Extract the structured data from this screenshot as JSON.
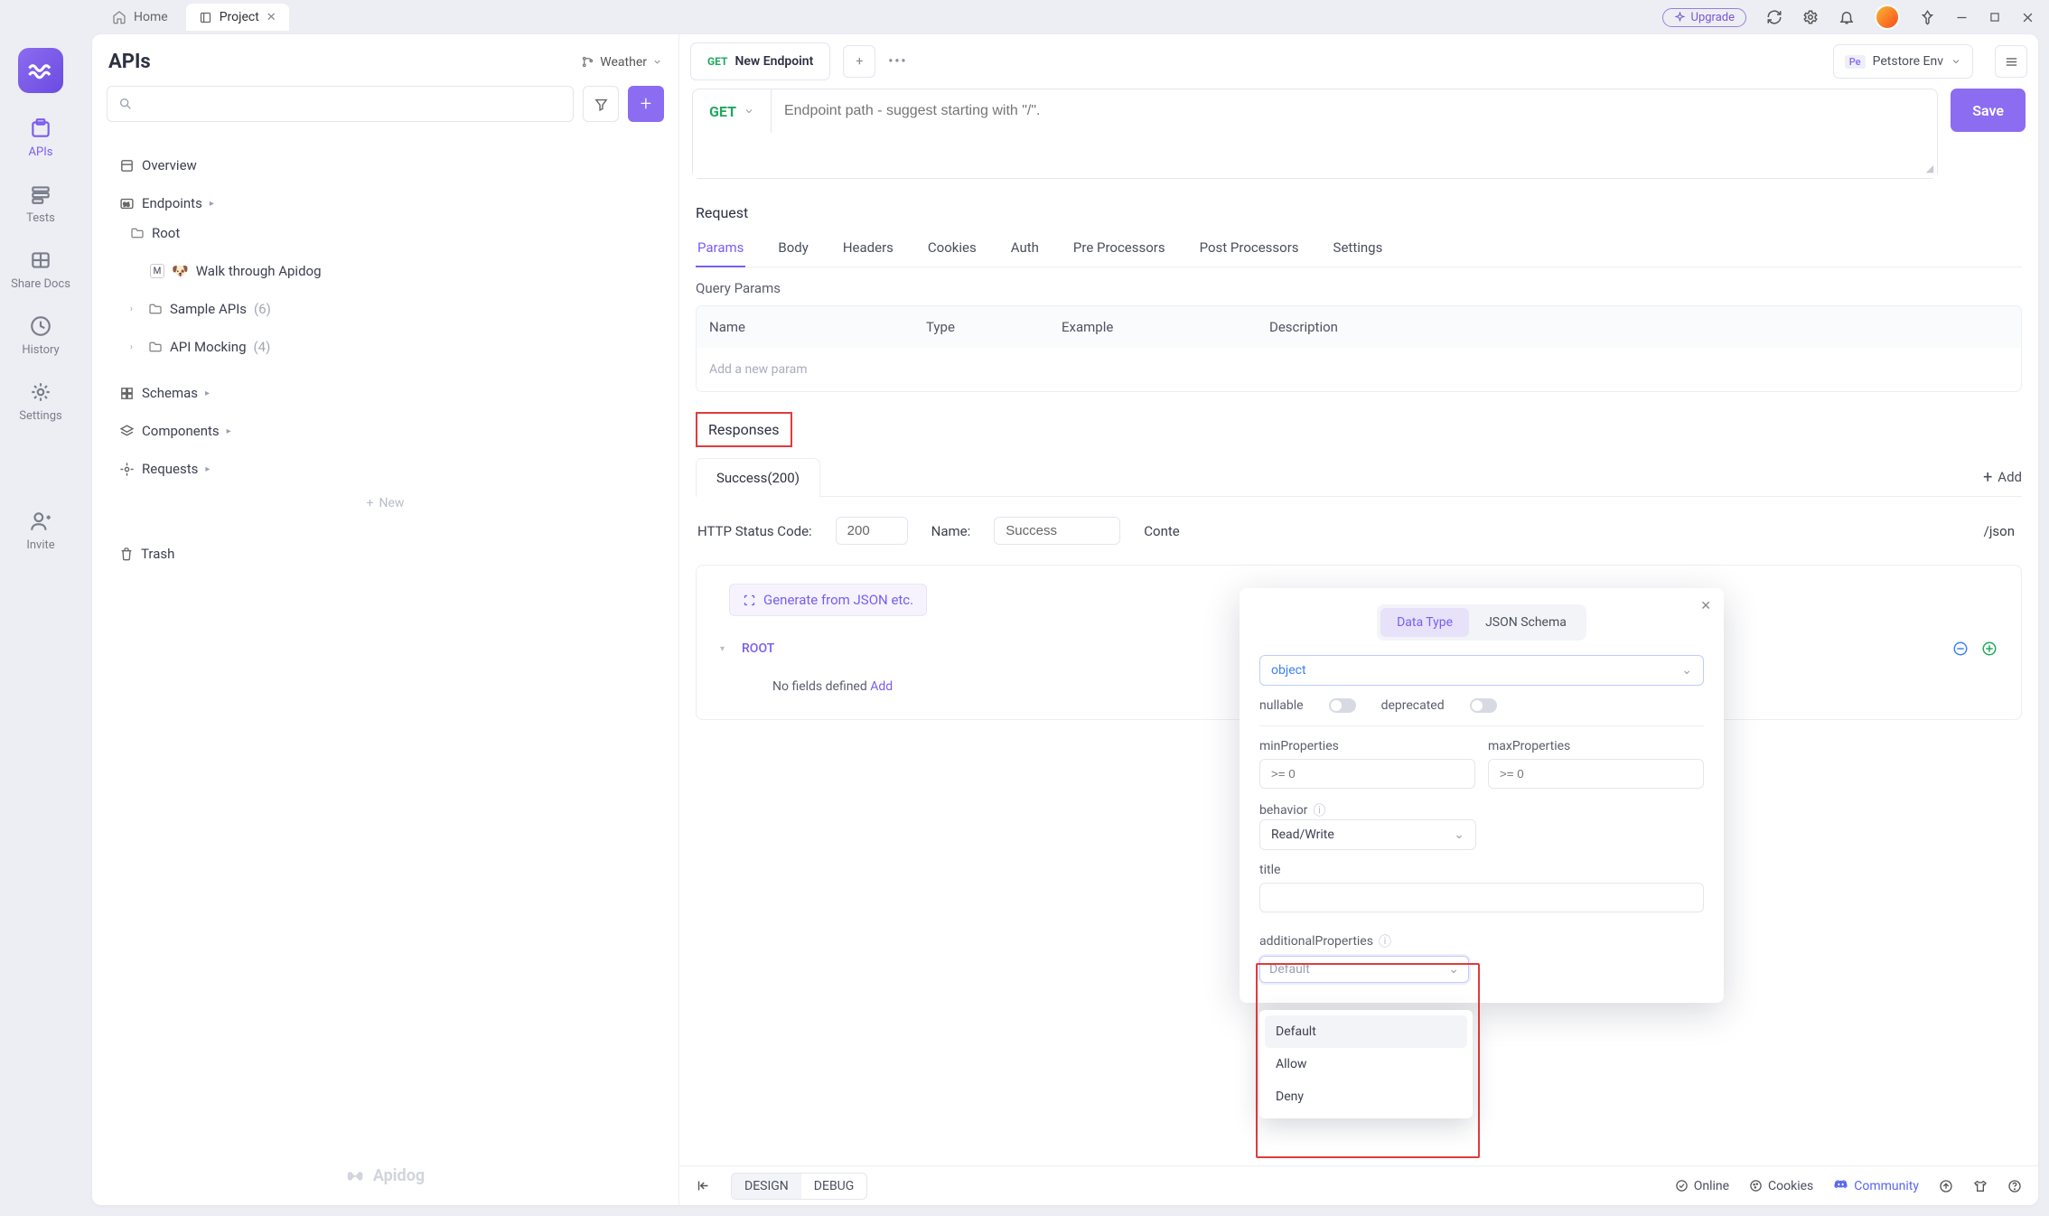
{
  "window": {
    "tabs": [
      {
        "label": "Home",
        "active": false
      },
      {
        "label": "Project",
        "active": true
      }
    ],
    "upgrade": "Upgrade"
  },
  "iconbar": {
    "items": [
      {
        "id": "apis",
        "label": "APIs",
        "active": true
      },
      {
        "id": "tests",
        "label": "Tests",
        "active": false
      },
      {
        "id": "share",
        "label": "Share Docs",
        "active": false
      },
      {
        "id": "history",
        "label": "History",
        "active": false
      },
      {
        "id": "settings",
        "label": "Settings",
        "active": false
      },
      {
        "id": "invite",
        "label": "Invite",
        "active": false
      }
    ]
  },
  "sidebar": {
    "title": "APIs",
    "weather": "Weather",
    "tree": {
      "overview": "Overview",
      "endpoints": "Endpoints",
      "root": "Root",
      "walkthrough": "Walk through Apidog",
      "sample_apis": "Sample APIs",
      "sample_apis_count": "(6)",
      "api_mocking": "API Mocking",
      "api_mocking_count": "(4)",
      "schemas": "Schemas",
      "components": "Components",
      "requests": "Requests",
      "new": "New",
      "trash": "Trash"
    },
    "brand": "Apidog"
  },
  "tabbar": {
    "method": "GET",
    "title": "New Endpoint",
    "env_badge": "Pe",
    "env_name": "Petstore Env"
  },
  "request_line": {
    "method": "GET",
    "placeholder": "Endpoint path - suggest starting with \"/\".",
    "save": "Save"
  },
  "request_section": {
    "label": "Request",
    "tabs": [
      "Params",
      "Body",
      "Headers",
      "Cookies",
      "Auth",
      "Pre Processors",
      "Post Processors",
      "Settings"
    ],
    "active_tab": "Params",
    "query_label": "Query Params",
    "columns": [
      "Name",
      "Type",
      "Example",
      "Description"
    ],
    "add_placeholder": "Add a new param"
  },
  "responses": {
    "label": "Responses",
    "tab": "Success(200)",
    "add": "Add",
    "status_label": "HTTP Status Code:",
    "status_value": "200",
    "name_label": "Name:",
    "name_value": "Success",
    "content_label_partial_left": "Conte",
    "content_value_partial_right": "/json",
    "generate": "Generate from JSON etc.",
    "root": "ROOT",
    "object_type": "object",
    "no_fields": "No fields defined",
    "add_field": "Add"
  },
  "popover": {
    "tabs": {
      "datatype": "Data Type",
      "jsonschema": "JSON Schema"
    },
    "type": "object",
    "nullable": "nullable",
    "deprecated": "deprecated",
    "minProperties": {
      "label": "minProperties",
      "placeholder": ">= 0"
    },
    "maxProperties": {
      "label": "maxProperties",
      "placeholder": ">= 0"
    },
    "behavior": {
      "label": "behavior",
      "value": "Read/Write"
    },
    "title_label": "title",
    "additionalProperties": {
      "label": "additionalProperties",
      "value": "Default",
      "options": [
        "Default",
        "Allow",
        "Deny"
      ]
    }
  },
  "bottom": {
    "design": "DESIGN",
    "debug": "DEBUG",
    "online": "Online",
    "cookies": "Cookies",
    "community": "Community"
  }
}
